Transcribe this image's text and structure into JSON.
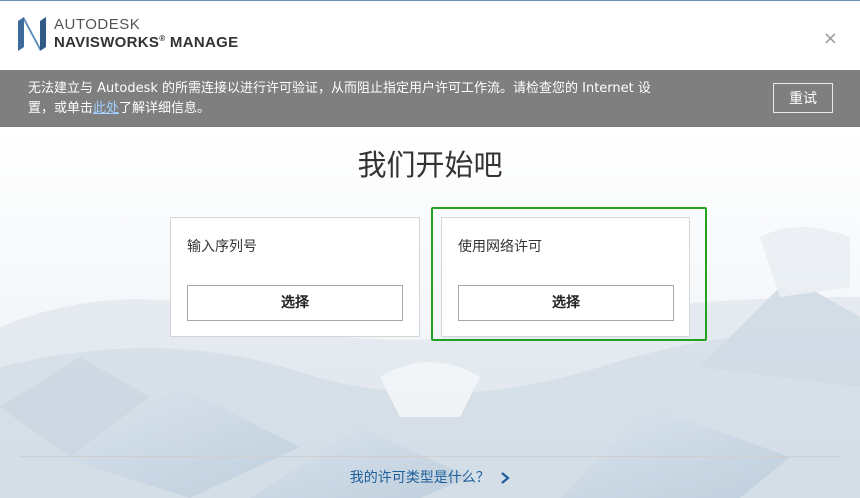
{
  "header": {
    "brand_top": "AUTODESK",
    "brand_bottom": "NAVISWORKS",
    "brand_suffix": "MANAGE",
    "close_symbol": "×"
  },
  "warning": {
    "message_part1": "无法建立与 Autodesk 的所需连接以进行许可验证，从而阻止指定用户许可工作流。请检查您的 Internet 设置，或单击",
    "link_text": "此处",
    "message_part2": "了解详细信息。",
    "retry_label": "重试"
  },
  "main": {
    "title": "我们开始吧",
    "options": [
      {
        "label": "输入序列号",
        "button": "选择"
      },
      {
        "label": "使用网络许可",
        "button": "选择"
      }
    ],
    "selected_index": 1
  },
  "footer": {
    "help_link": "我的许可类型是什么？"
  },
  "colors": {
    "warning_bg": "#7f7f7f",
    "selection_outline": "#21a321",
    "link": "#1d5f9a"
  },
  "icons": [
    "autodesk-n-logo-icon",
    "close-icon",
    "chevron-right-icon"
  ]
}
